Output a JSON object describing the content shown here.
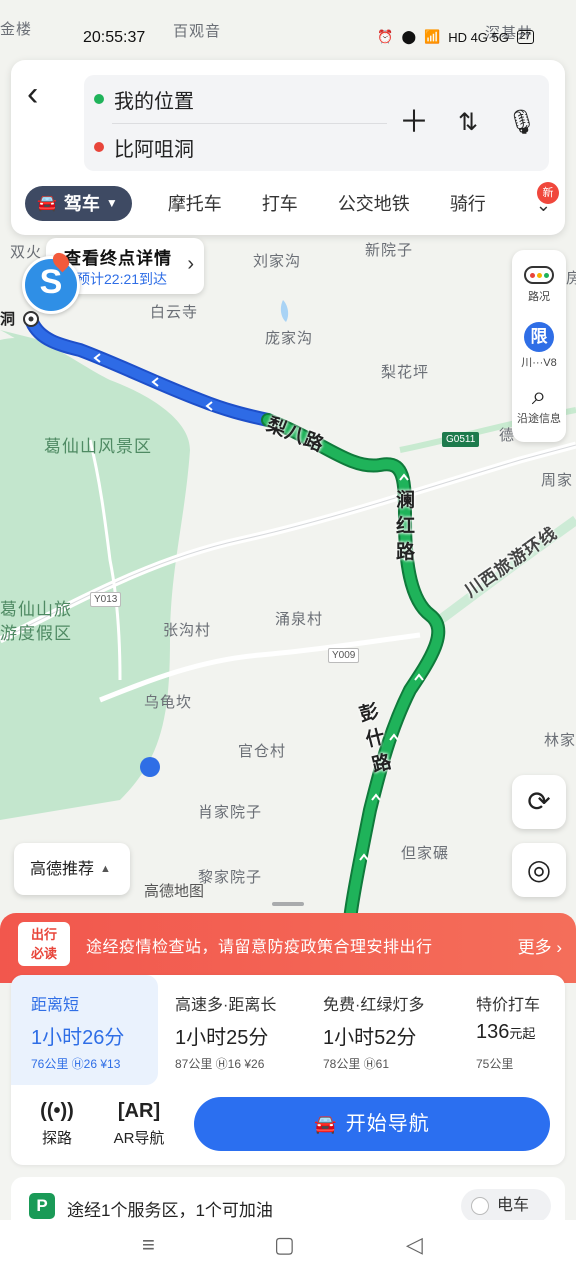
{
  "status_bar": {
    "time": "20:55:37",
    "indicators": "HD 4G 5G",
    "battery": "27"
  },
  "search": {
    "origin": "我的位置",
    "destination": "比阿咀洞",
    "origin_color": "#1fb35a",
    "destination_color": "#e8453a"
  },
  "modes": {
    "active": "驾车",
    "items": [
      "摩托车",
      "打车",
      "公交地铁",
      "骑行"
    ],
    "new_badge": "新"
  },
  "map": {
    "dest_bubble": {
      "title": "查看终点详情",
      "eta": "预计22:21到达"
    },
    "labels": {
      "jinlou": "金楼",
      "baiguanyin": "百观音",
      "shenjing": "深基井",
      "shuanghuo": "双火",
      "dong": "洞",
      "liujiagou": "刘家沟",
      "xinyuanzi": "新院子",
      "baiyunsi": "白云寺",
      "pangjiagou": "庞家沟",
      "lihuaping": "梨花坪",
      "gexianshan": "葛仙山风景区",
      "gexianshan_resort": "葛仙山旅游度假区",
      "zhanggoucun": "张沟村",
      "yongquancun": "涌泉村",
      "wuguikan": "乌龟坎",
      "guancangcun": "官仓村",
      "xiaojiayuanzi": "肖家院子",
      "lijiayuanzi": "黎家院子",
      "danjianian": "但家碾",
      "zhoujia": "周家",
      "linjia": "林家",
      "fang": "房",
      "de": "德",
      "gao": "高德地图"
    },
    "roads": {
      "liba": "梨八路",
      "lanhong": "澜红路",
      "pengshi": "彭什路",
      "chuanxi": "川西旅游环线"
    },
    "shields": {
      "g0511": "G0511",
      "y013": "Y013",
      "y009": "Y009"
    },
    "side_panel": {
      "traffic": "路况",
      "limit_char": "限",
      "limit_text": "川···V8",
      "along": "沿途信息"
    },
    "recommend": "高德推荐",
    "colors": {
      "route_blue": "#2e6be6",
      "route_green": "#1fb35a",
      "park_green": "#bfe5c9"
    }
  },
  "sheet": {
    "notice": {
      "tag_line1": "出行",
      "tag_line2": "必读",
      "message": "途经疫情检查站，请留意防疫政策合理安排出行",
      "more": "更多"
    },
    "routes": [
      {
        "label": "距离短",
        "duration": "1小时26分",
        "detail": "76公里 Ⓗ26 ¥13",
        "selected": true
      },
      {
        "label": "高速多·距离长",
        "duration": "1小时25分",
        "detail": "87公里 Ⓗ16 ¥26",
        "selected": false
      },
      {
        "label": "免费·红绿灯多",
        "duration": "1小时52分",
        "detail": "78公里 Ⓗ61",
        "selected": false
      },
      {
        "label": "特价打车",
        "duration": "136",
        "duration_unit": "元起",
        "detail": "75公里",
        "selected": false
      }
    ],
    "actions": {
      "explore": "探路",
      "ar": "AR导航",
      "start": "开始导航"
    },
    "service": {
      "text": "途经1个服务区，1个可加油",
      "ev": "电车"
    }
  }
}
